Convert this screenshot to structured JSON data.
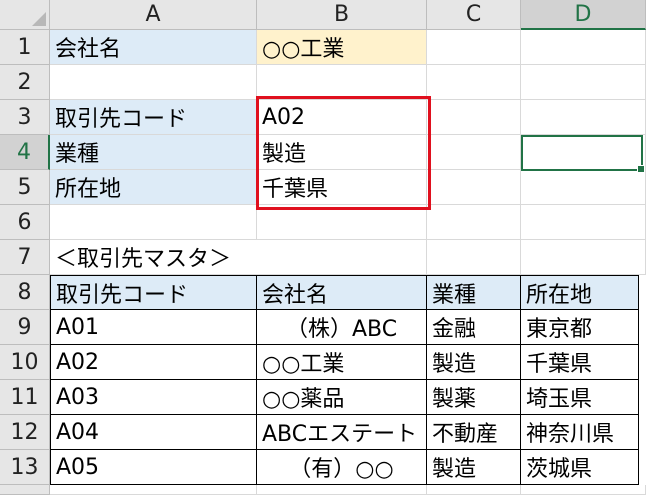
{
  "columns": [
    "A",
    "B",
    "C",
    "D"
  ],
  "active_column": "D",
  "rows": [
    "1",
    "2",
    "3",
    "4",
    "5",
    "6",
    "7",
    "8",
    "9",
    "10",
    "11",
    "12",
    "13"
  ],
  "active_row": "4",
  "lookup": {
    "company_label": "会社名",
    "company_value": "○○工業",
    "code_label": "取引先コード",
    "code_value": "A02",
    "industry_label": "業種",
    "industry_value": "製造",
    "location_label": "所在地",
    "location_value": "千葉県"
  },
  "master": {
    "title": "＜取引先マスタ＞",
    "headers": [
      "取引先コード",
      "会社名",
      "業種",
      "所在地"
    ],
    "rows": [
      [
        "A01",
        "（株）ABC",
        "金融",
        "東京都"
      ],
      [
        "A02",
        "○○工業",
        "製造",
        "千葉県"
      ],
      [
        "A03",
        "○○薬品",
        "製薬",
        "埼玉県"
      ],
      [
        "A04",
        "ABCエステート",
        "不動産",
        "神奈川県"
      ],
      [
        "A05",
        "（有）○○",
        "製造",
        "茨城県"
      ]
    ]
  },
  "colors": {
    "label_fill": "#ddebf7",
    "value_fill": "#fff2cc",
    "highlight_border": "#e0101e",
    "selection": "#217346"
  },
  "selected_cell": "D4"
}
